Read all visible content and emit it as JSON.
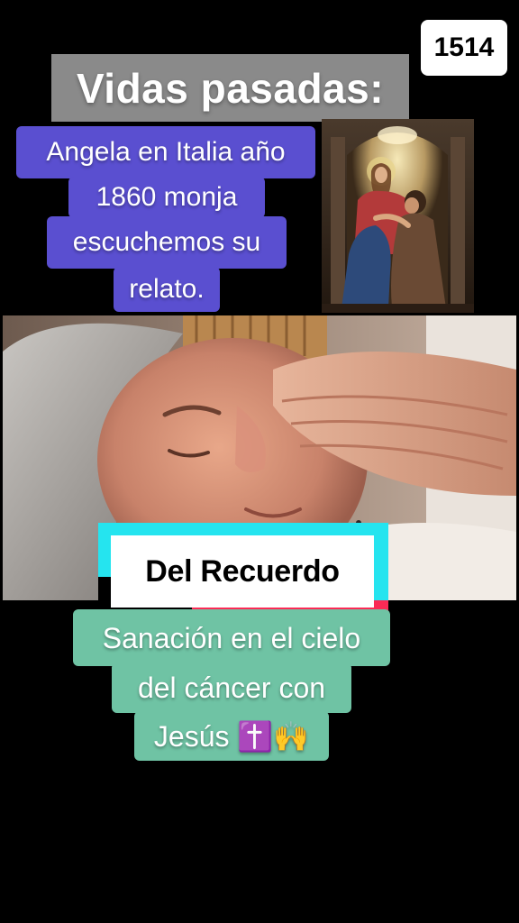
{
  "counter": "1514",
  "title": "Vidas pasadas:",
  "caption_purple": {
    "line1": "Angela en Italia año",
    "line2": "1860 monja",
    "line3": "escuchemos su",
    "line4": "relato."
  },
  "logo_text": "Del Recuerdo",
  "caption_green": {
    "line1": "Sanación en el cielo",
    "line2": "del cáncer con",
    "line3": "Jesús ✝️🙌"
  },
  "colors": {
    "purple": "#5a4fd0",
    "green": "#6fc3a4",
    "title_bg": "#8a8a8a",
    "logo_cyan": "#25e4ef",
    "logo_pink": "#fa2a55"
  }
}
